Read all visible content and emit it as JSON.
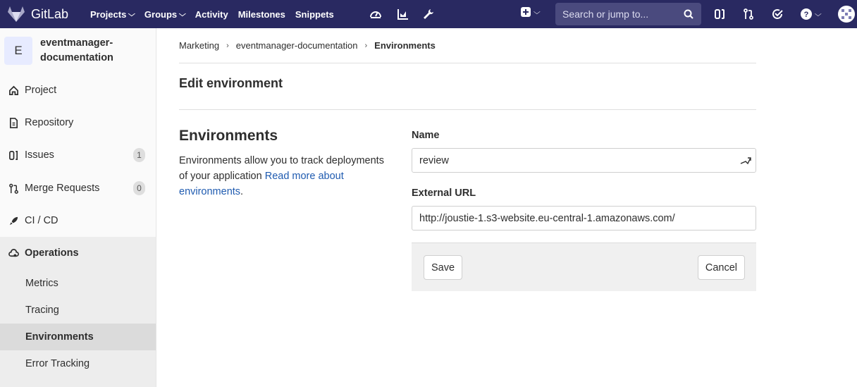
{
  "app": {
    "brand": "GitLab"
  },
  "navbar": {
    "links": [
      {
        "label": "Projects",
        "dropdown": true
      },
      {
        "label": "Groups",
        "dropdown": true
      },
      {
        "label": "Activity",
        "dropdown": false
      },
      {
        "label": "Milestones",
        "dropdown": false
      },
      {
        "label": "Snippets",
        "dropdown": false
      }
    ],
    "search_placeholder": "Search or jump to...",
    "icons": [
      "admin-dashboard-icon",
      "analytics-chart-icon",
      "wrench-icon",
      "plus-square-icon",
      "issues-icon",
      "merge-request-icon",
      "todo-check-icon",
      "help-icon",
      "user-avatar-icon"
    ]
  },
  "sidebar": {
    "avatar_letter": "E",
    "project_name": "eventmanager-documentation",
    "items": [
      {
        "label": "Project",
        "icon": "home-icon"
      },
      {
        "label": "Repository",
        "icon": "doc-icon"
      },
      {
        "label": "Issues",
        "icon": "issues-icon",
        "badge": "1"
      },
      {
        "label": "Merge Requests",
        "icon": "merge-request-icon",
        "badge": "0"
      },
      {
        "label": "CI / CD",
        "icon": "rocket-icon"
      },
      {
        "label": "Operations",
        "icon": "cloud-gear-icon"
      }
    ],
    "sub_items": [
      {
        "label": "Metrics"
      },
      {
        "label": "Tracing"
      },
      {
        "label": "Environments",
        "active": true
      },
      {
        "label": "Error Tracking"
      }
    ]
  },
  "breadcrumb": [
    "Marketing",
    "eventmanager-documentation",
    "Environments"
  ],
  "page": {
    "title": "Edit environment",
    "section_title": "Environments",
    "description": "Environments allow you to track deployments of your application ",
    "description_link": "Read more about environments",
    "description_end": ".",
    "name_label": "Name",
    "name_value": "review",
    "url_label": "External URL",
    "url_value": "http://joustie-1.s3-website.eu-central-1.amazonaws.com/",
    "save_label": "Save",
    "cancel_label": "Cancel"
  },
  "colors": {
    "navbar": "#292961",
    "link": "#1f5bb0",
    "sidebar_bg": "#fafafa",
    "active_bg": "#dbdbdb"
  }
}
